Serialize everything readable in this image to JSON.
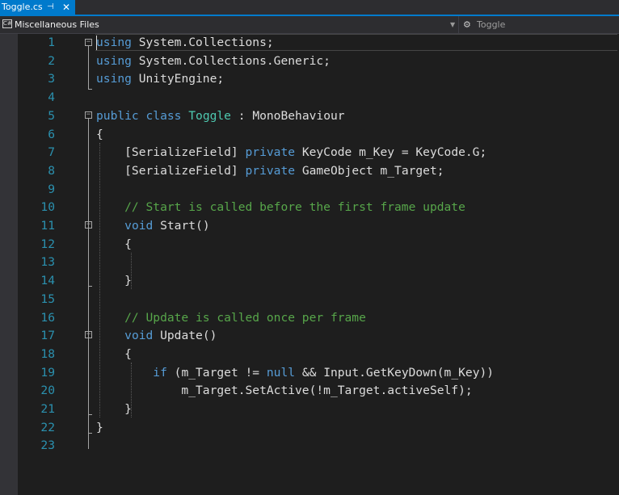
{
  "tab": {
    "title": "Toggle.cs",
    "pin_icon": "pin-icon",
    "close_icon": "close-icon"
  },
  "navbar": {
    "project": "Miscellaneous Files",
    "project_icon": "csharp-file-icon",
    "member": "Toggle",
    "member_icon": "class-member-icon"
  },
  "editor": {
    "line_numbers": [
      "1",
      "2",
      "3",
      "4",
      "5",
      "6",
      "7",
      "8",
      "9",
      "10",
      "11",
      "12",
      "13",
      "14",
      "15",
      "16",
      "17",
      "18",
      "19",
      "20",
      "21",
      "22",
      "23"
    ],
    "lines": [
      [
        [
          "kw",
          "using"
        ],
        [
          "t",
          " System.Collections;"
        ]
      ],
      [
        [
          "kw",
          "using"
        ],
        [
          "t",
          " System.Collections.Generic;"
        ]
      ],
      [
        [
          "kw",
          "using"
        ],
        [
          "t",
          " UnityEngine;"
        ]
      ],
      [],
      [
        [
          "kw",
          "public"
        ],
        [
          "t",
          " "
        ],
        [
          "kw",
          "class"
        ],
        [
          "t",
          " "
        ],
        [
          "ty",
          "Toggle"
        ],
        [
          "t",
          " : MonoBehaviour"
        ]
      ],
      [
        [
          "t",
          "{"
        ]
      ],
      [
        [
          "t",
          "    [SerializeField] "
        ],
        [
          "kw",
          "private"
        ],
        [
          "t",
          " KeyCode m_Key = KeyCode.G;"
        ]
      ],
      [
        [
          "t",
          "    [SerializeField] "
        ],
        [
          "kw",
          "private"
        ],
        [
          "t",
          " GameObject m_Target;"
        ]
      ],
      [],
      [
        [
          "cm",
          "    // Start is called before the first frame update"
        ]
      ],
      [
        [
          "t",
          "    "
        ],
        [
          "kw",
          "void"
        ],
        [
          "t",
          " Start()"
        ]
      ],
      [
        [
          "t",
          "    {"
        ]
      ],
      [],
      [
        [
          "t",
          "    }"
        ]
      ],
      [],
      [
        [
          "cm",
          "    // Update is called once per frame"
        ]
      ],
      [
        [
          "t",
          "    "
        ],
        [
          "kw",
          "void"
        ],
        [
          "t",
          " Update()"
        ]
      ],
      [
        [
          "t",
          "    {"
        ]
      ],
      [
        [
          "t",
          "        "
        ],
        [
          "kw",
          "if"
        ],
        [
          "t",
          " (m_Target != "
        ],
        [
          "kw",
          "null"
        ],
        [
          "t",
          " && Input.GetKeyDown(m_Key))"
        ]
      ],
      [
        [
          "t",
          "            m_Target.SetActive(!m_Target.activeSelf);"
        ]
      ],
      [
        [
          "t",
          "    }"
        ]
      ],
      [
        [
          "t",
          "}"
        ]
      ],
      []
    ]
  },
  "colors": {
    "keyword": "#569cd6",
    "type": "#4ec9b0",
    "comment": "#57a64a",
    "line_number": "#2b91af",
    "accent": "#007acc"
  }
}
